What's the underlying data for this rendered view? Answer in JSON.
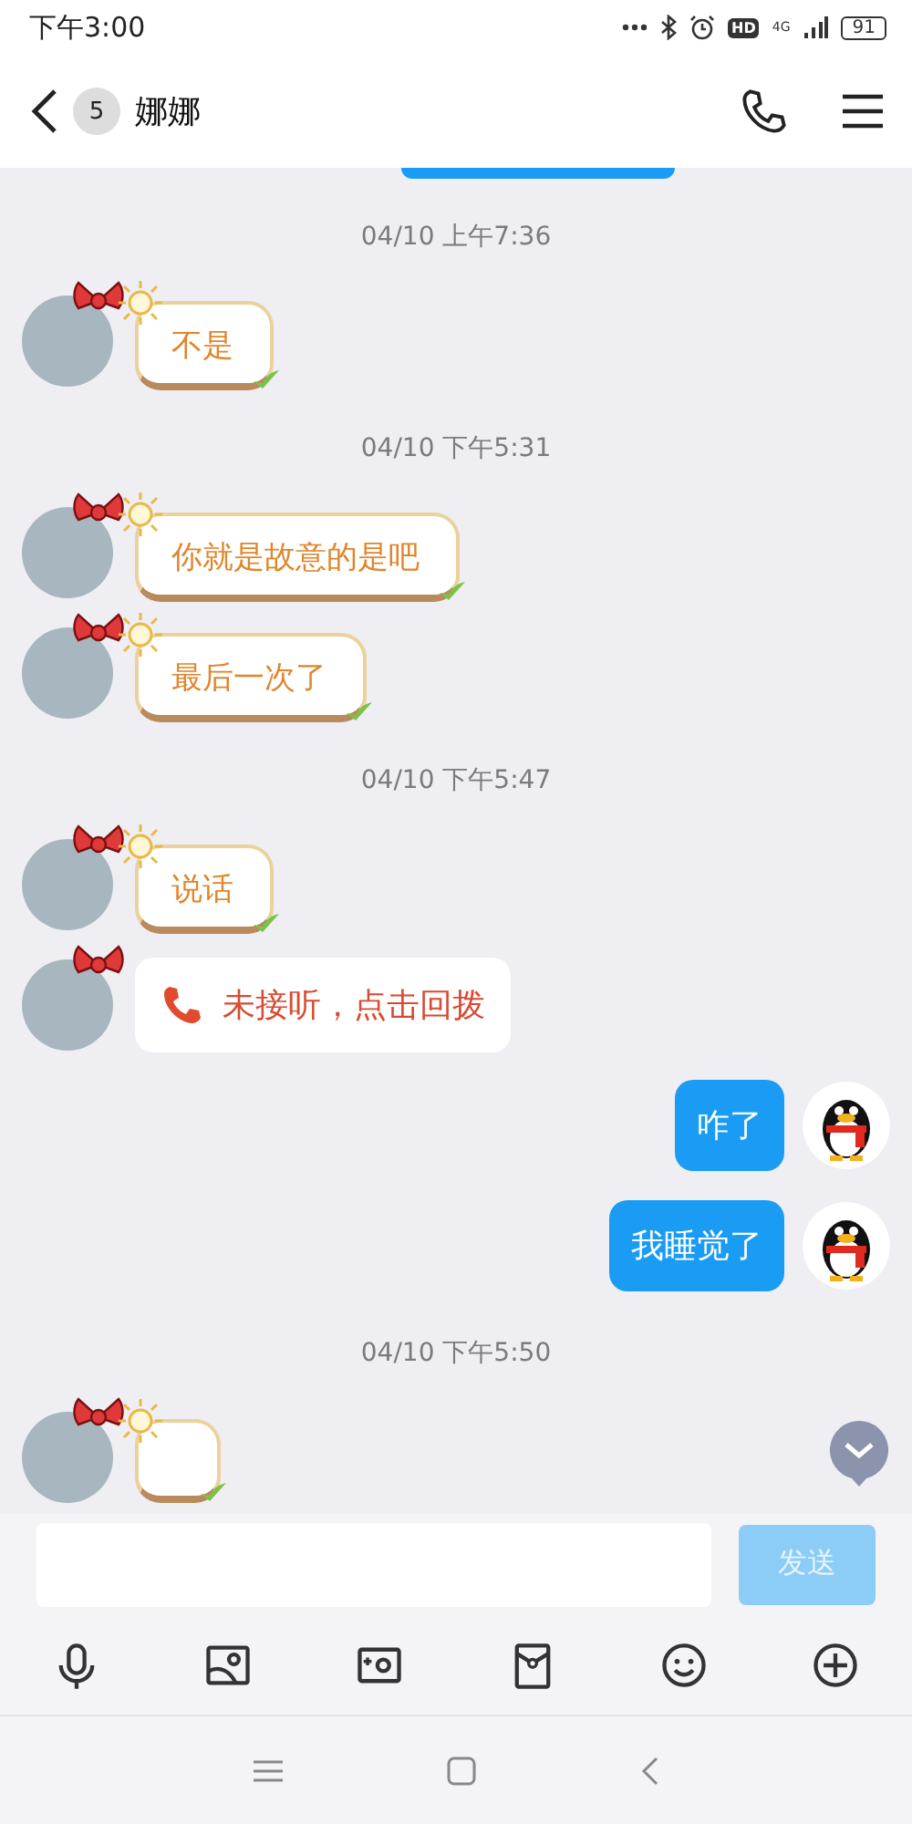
{
  "status_bar": {
    "time": "下午3:00",
    "hd": "HD",
    "network": "4G",
    "battery": "91"
  },
  "header": {
    "unread_count": "5",
    "contact_name": "娜娜"
  },
  "messages": [
    {
      "kind": "cutoff_sent"
    },
    {
      "kind": "time",
      "text": "04/10 上午7:36"
    },
    {
      "kind": "themed",
      "text": "不是"
    },
    {
      "kind": "time",
      "text": "04/10 下午5:31"
    },
    {
      "kind": "themed",
      "text": "你就是故意的是吧"
    },
    {
      "kind": "themed",
      "text": "最后一次了"
    },
    {
      "kind": "time",
      "text": "04/10 下午5:47"
    },
    {
      "kind": "themed",
      "text": "说话"
    },
    {
      "kind": "call",
      "text": "未接听，点击回拨"
    },
    {
      "kind": "sent",
      "text": "咋了"
    },
    {
      "kind": "sent",
      "text": "我睡觉了"
    },
    {
      "kind": "time",
      "text": "04/10 下午5:50"
    },
    {
      "kind": "cutoff_themed"
    }
  ],
  "composer": {
    "send_label": "发送",
    "send_disabled": true
  }
}
